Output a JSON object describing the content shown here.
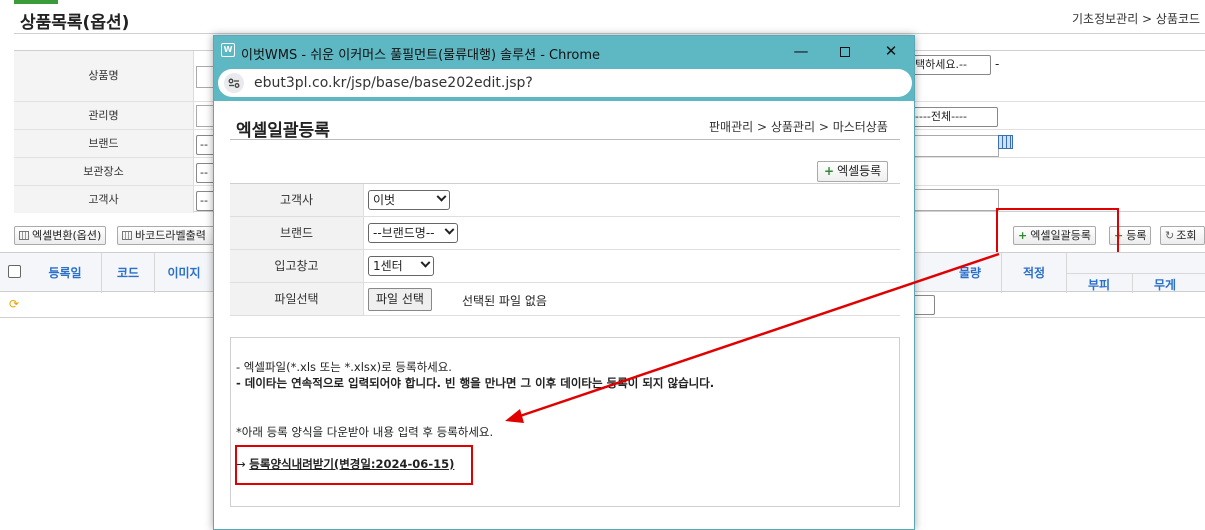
{
  "page": {
    "title": "상품목록(옵션)",
    "breadcrumb": "기초정보관리 > 상품코드"
  },
  "search": {
    "labels": [
      "상품명",
      "관리명",
      "브랜드",
      "보관장소",
      "고객사"
    ],
    "select_right_1": "택하세요.--",
    "dash": "-",
    "select_right_2": "----전체----",
    "brand_prefix": "--",
    "storage_prefix": "--",
    "customer_prefix": "--"
  },
  "toolbar": {
    "excel_convert": "엑셀변환(옵션)",
    "barcode_label": "바코드라벨출력",
    "excel_bulk_register": "엑셀일괄등록",
    "register": "등록",
    "search": "조회"
  },
  "grid": {
    "headers": [
      "등록일",
      "코드",
      "이미지"
    ],
    "right_headers": [
      "물량",
      "적정",
      "부피",
      "무게"
    ]
  },
  "popup": {
    "window_title": "이벗WMS - 쉬운 이커머스 풀필먼트(물류대행) 솔루션 - Chrome",
    "url": "ebut3pl.co.kr/jsp/base/base202edit.jsp?",
    "heading": "엑셀일괄등록",
    "breadcrumb": "판매관리 > 상품관리 > 마스터상품",
    "excel_register_button": "엑셀등록",
    "form": {
      "customer_label": "고객사",
      "customer_value": "이벗",
      "brand_label": "브랜드",
      "brand_value": "--브랜드명--",
      "warehouse_label": "입고창고",
      "warehouse_value": "1센터",
      "file_label": "파일선택",
      "file_button": "파일 선택",
      "file_status": "선택된 파일 없음"
    },
    "info": {
      "line1": "- 엑셀파일(*.xls 또는 *.xlsx)로 등록하세요.",
      "line2": "- 데이타는 연속적으로 입력되어야 합니다. 빈 행을 만나면 그 이후 데이타는 등록이 되지 않습니다.",
      "line3": "*아래 등록 양식을 다운받아 내용 입력 후 등록하세요.",
      "arrow": "→",
      "download_link": "등록양식내려받기(변경일:2024-06-15)"
    }
  },
  "colors": {
    "annotation_red": "#e00000",
    "titlebar": "#5db8c4",
    "header_blue": "#2a6fc9",
    "plus_green": "#2e8b2e"
  }
}
